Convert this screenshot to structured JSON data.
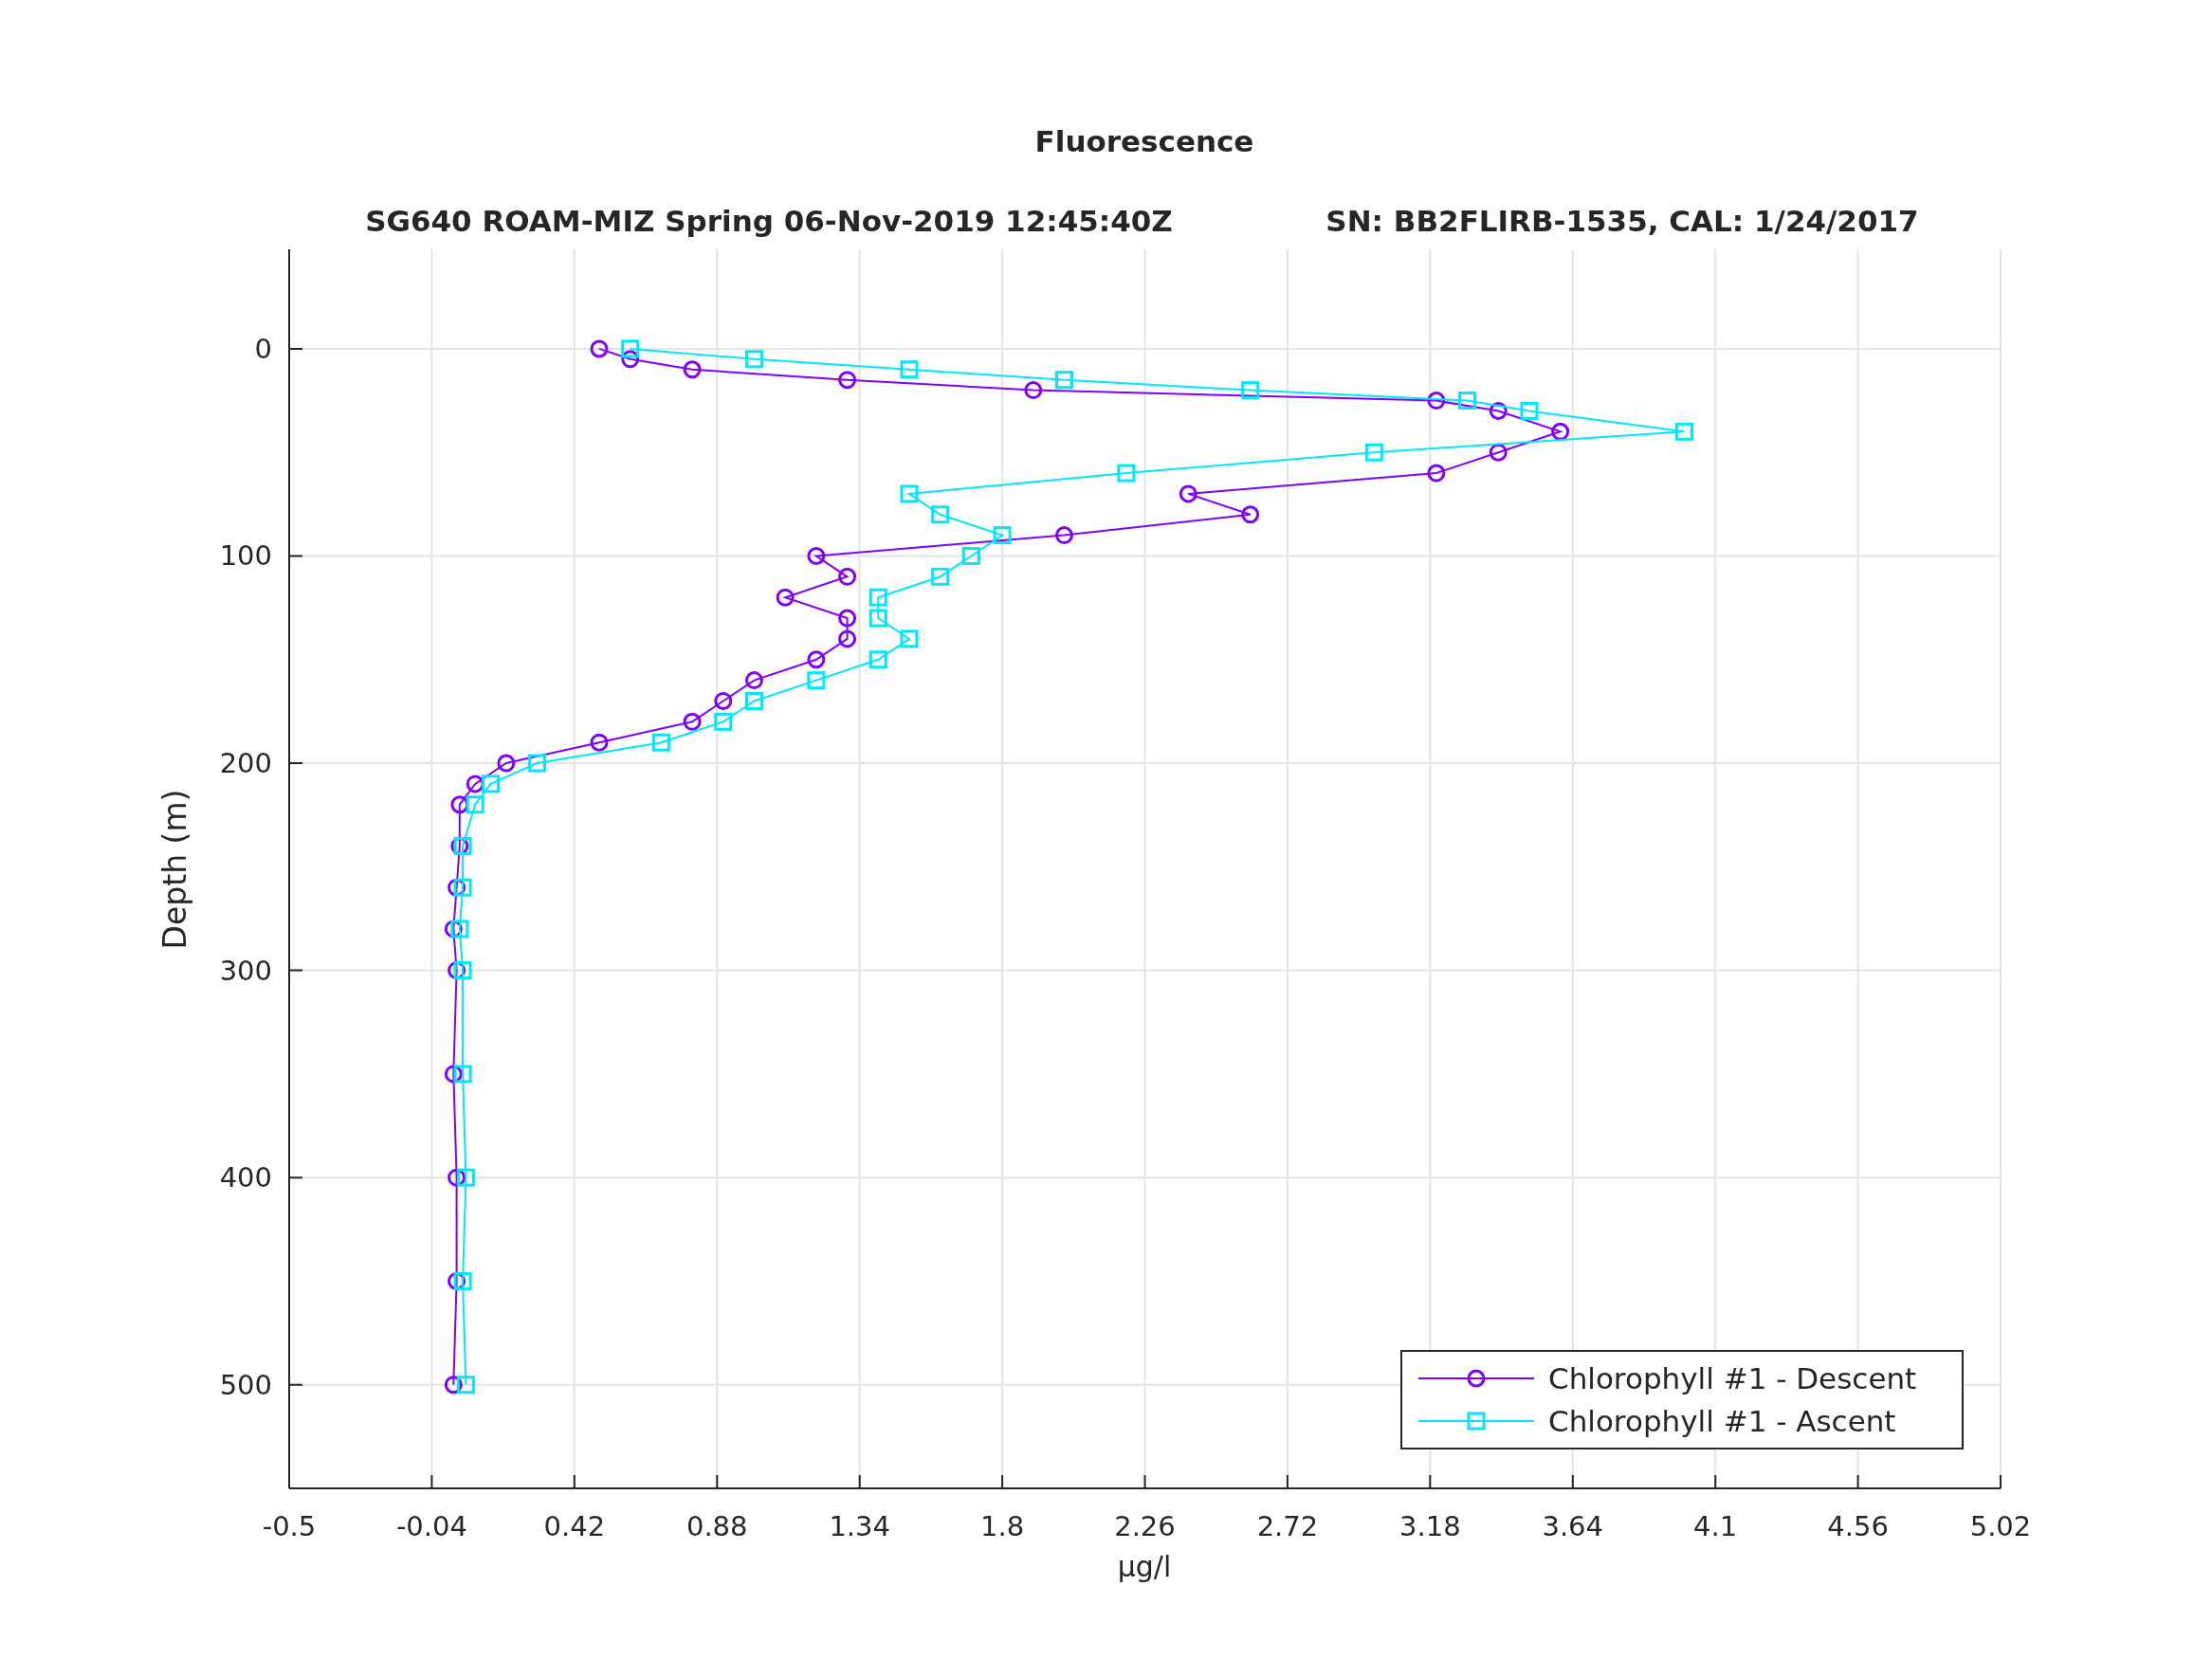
{
  "figure": {
    "subtitle": [
      "SG640 ROAM-MIZ Spring 06-Nov-2019 12:45:40Z",
      "SN: BB2FLIRB-1535, CAL: 1/24/2017"
    ]
  },
  "chart_data": {
    "type": "line",
    "orientation": "horizontal",
    "title": "Fluorescence",
    "xlabel": "μg/l",
    "ylabel": "Depth (m)",
    "x": [
      0,
      5,
      10,
      15,
      20,
      25,
      30,
      40,
      50,
      60,
      70,
      80,
      90,
      100,
      110,
      120,
      130,
      140,
      150,
      160,
      170,
      180,
      190,
      200,
      210,
      220,
      240,
      260,
      280,
      300,
      350,
      400,
      450,
      500
    ],
    "series": [
      {
        "name": "Chlorophyll #1 - Descent",
        "color": "#8000ff",
        "marker": "circle",
        "values": [
          0.5,
          0.6,
          0.8,
          1.3,
          1.9,
          3.2,
          3.4,
          3.6,
          3.4,
          3.2,
          2.4,
          2.6,
          2.0,
          1.2,
          1.3,
          1.1,
          1.3,
          1.3,
          1.2,
          1.0,
          0.9,
          0.8,
          0.5,
          0.2,
          0.1,
          0.05,
          0.05,
          0.04,
          0.03,
          0.04,
          0.03,
          0.04,
          0.04,
          0.03
        ]
      },
      {
        "name": "Chlorophyll #1 - Ascent",
        "color": "#00e6ff",
        "marker": "square",
        "values": [
          0.6,
          1.0,
          1.5,
          2.0,
          2.6,
          3.3,
          3.5,
          4.0,
          3.0,
          2.2,
          1.5,
          1.6,
          1.8,
          1.7,
          1.6,
          1.4,
          1.4,
          1.5,
          1.4,
          1.2,
          1.0,
          0.9,
          0.7,
          0.3,
          0.15,
          0.1,
          0.06,
          0.06,
          0.05,
          0.06,
          0.06,
          0.07,
          0.06,
          0.07
        ]
      }
    ],
    "xlim": [
      -0.5,
      5.02
    ],
    "ylim": [
      550,
      -48
    ],
    "xticks": [
      -0.5,
      -0.04,
      0.42,
      0.88,
      1.34,
      1.8,
      2.26,
      2.72,
      3.18,
      3.64,
      4.1,
      4.56,
      5.02
    ],
    "yticks": [
      0,
      100,
      200,
      300,
      400,
      500
    ],
    "grid": true,
    "legend": true
  }
}
